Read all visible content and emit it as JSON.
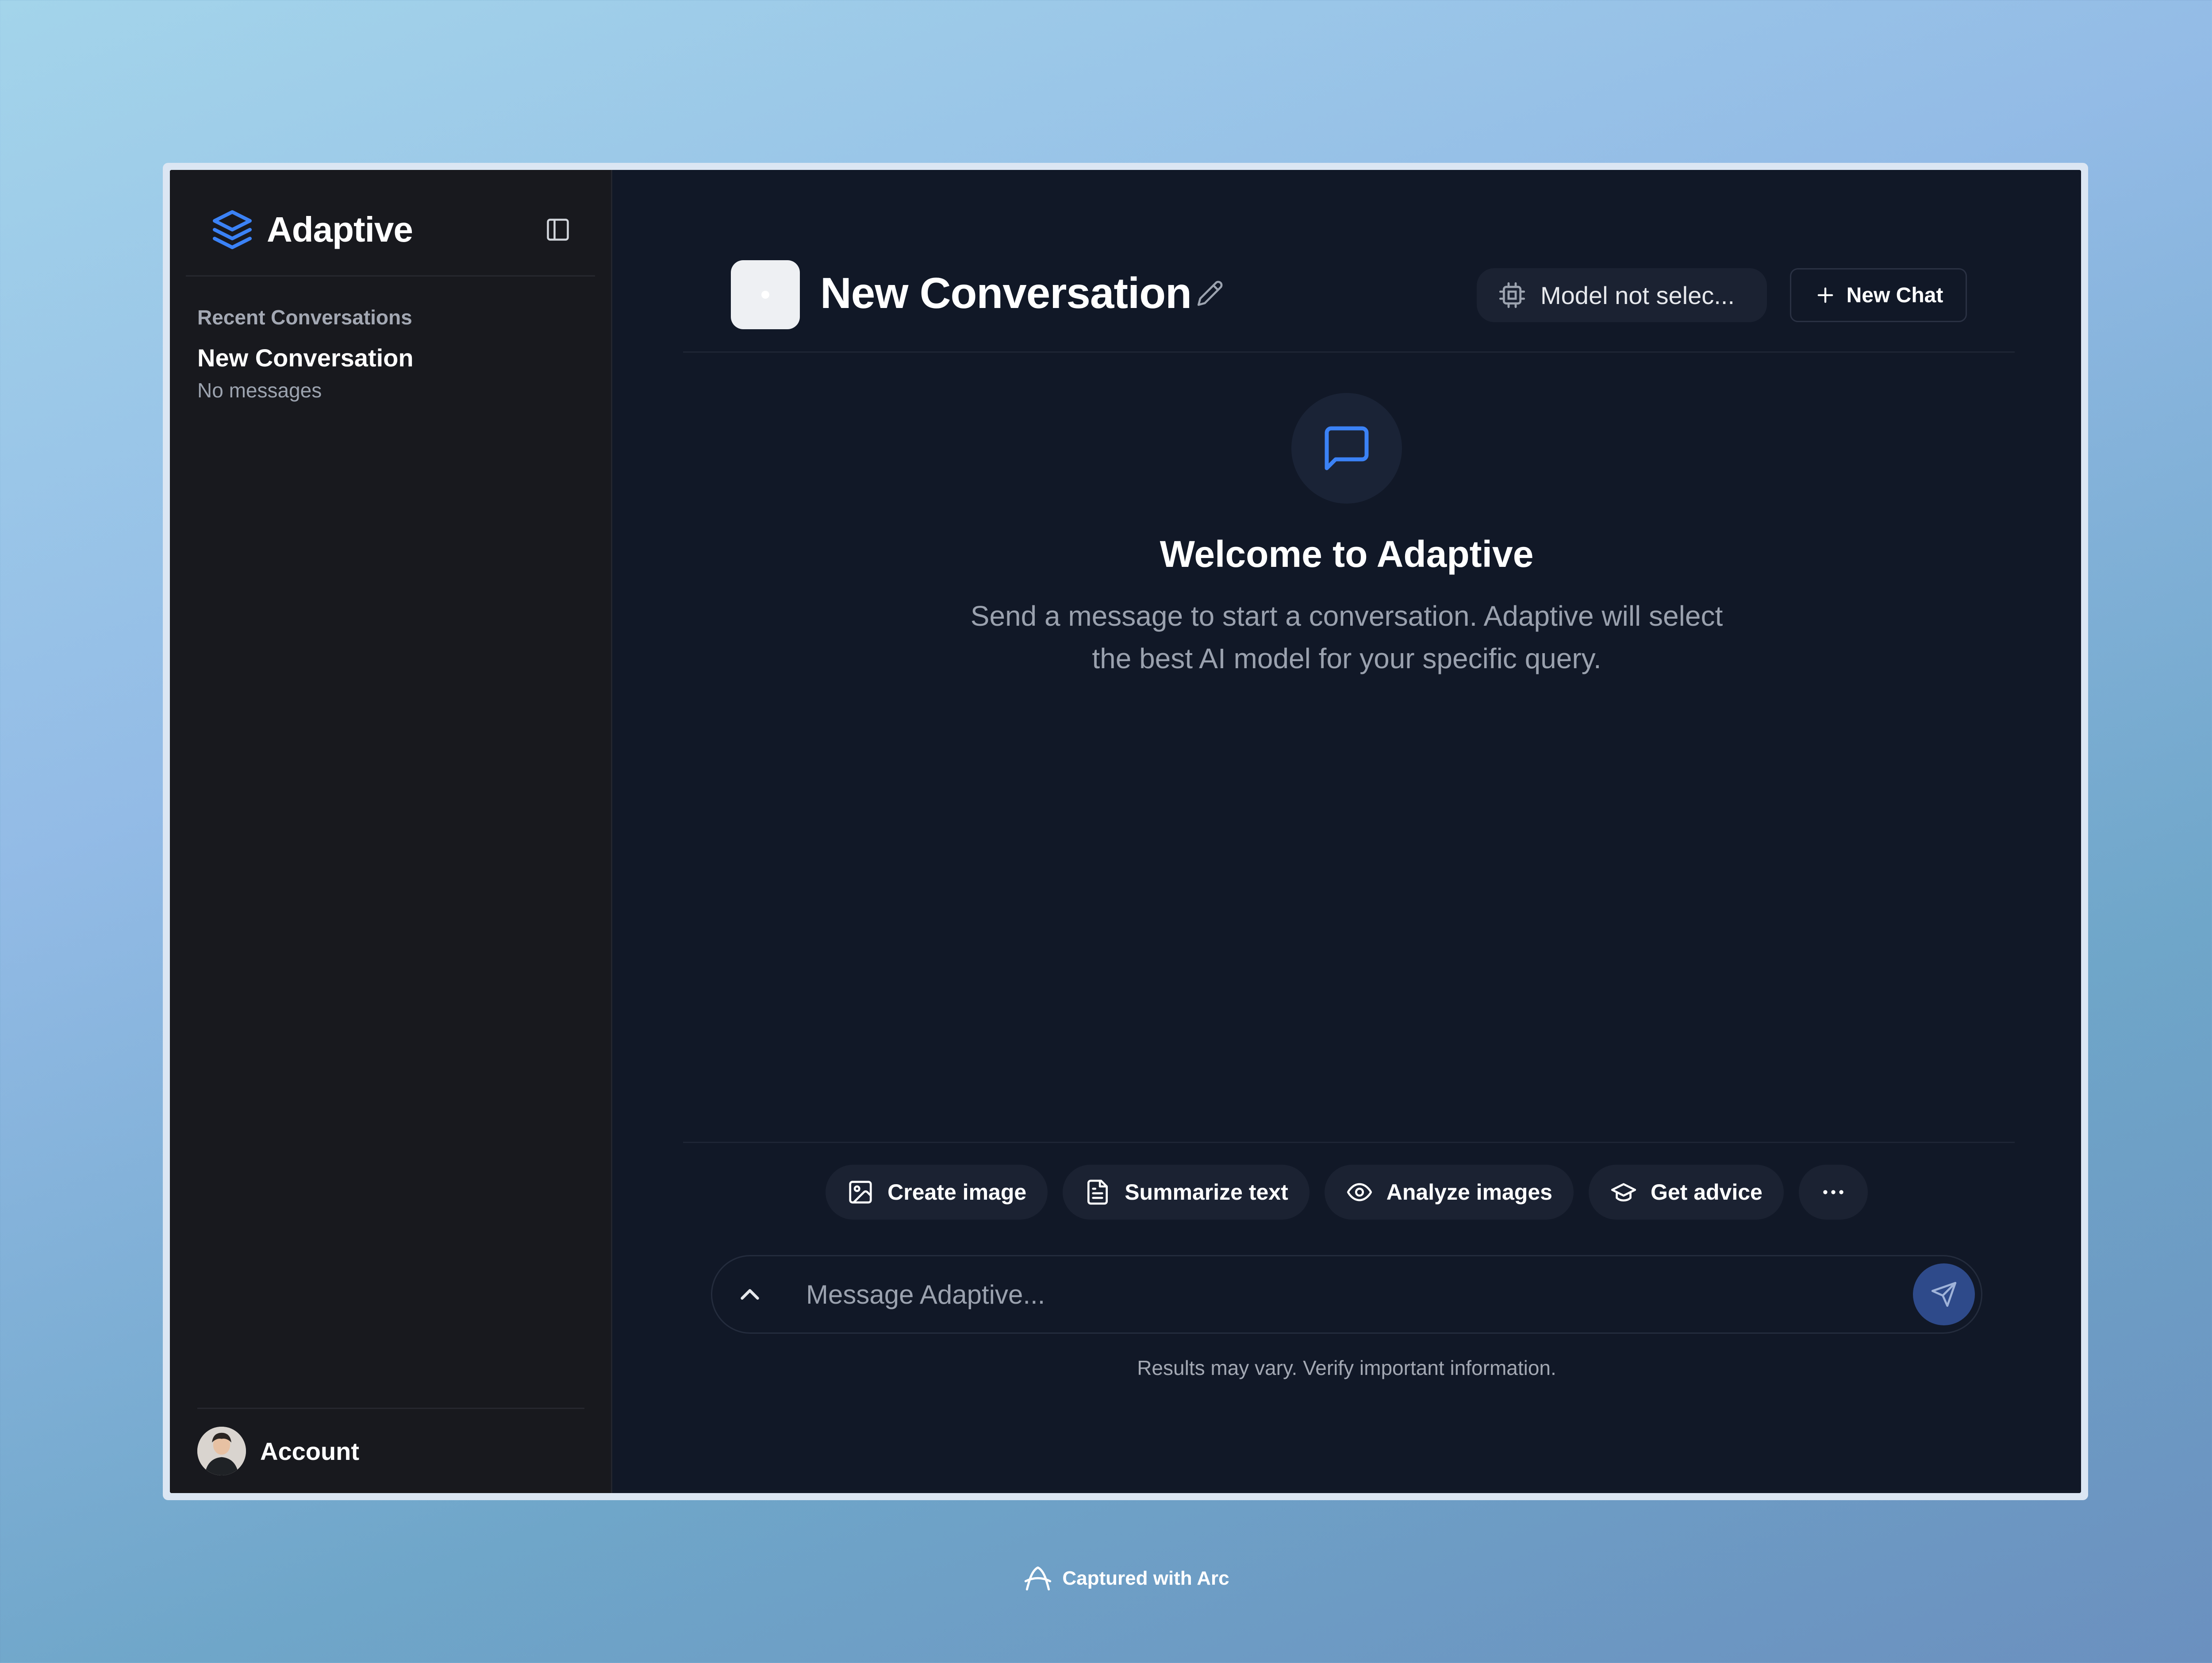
{
  "sidebar": {
    "brand": "Adaptive",
    "recent_label": "Recent Conversations",
    "conversations": [
      {
        "title": "New Conversation",
        "subtitle": "No messages"
      }
    ],
    "account_label": "Account"
  },
  "header": {
    "title": "New Conversation",
    "model_label": "Model not selec...",
    "new_chat_label": "New Chat"
  },
  "welcome": {
    "title": "Welcome to Adaptive",
    "subtitle": "Send a message to start a conversation. Adaptive will select the best AI model for your specific query."
  },
  "suggestions": [
    {
      "label": "Create image",
      "icon": "image-icon"
    },
    {
      "label": "Summarize text",
      "icon": "file-text-icon"
    },
    {
      "label": "Analyze images",
      "icon": "eye-icon"
    },
    {
      "label": "Get advice",
      "icon": "graduation-cap-icon"
    }
  ],
  "composer": {
    "placeholder": "Message Adaptive...",
    "disclaimer": "Results may vary. Verify important information."
  },
  "footer": {
    "captured_label": "Captured with Arc"
  },
  "colors": {
    "accent": "#3b82f6",
    "send_button": "#2e4a8a",
    "background": "#111827",
    "sidebar": "#18191e"
  }
}
